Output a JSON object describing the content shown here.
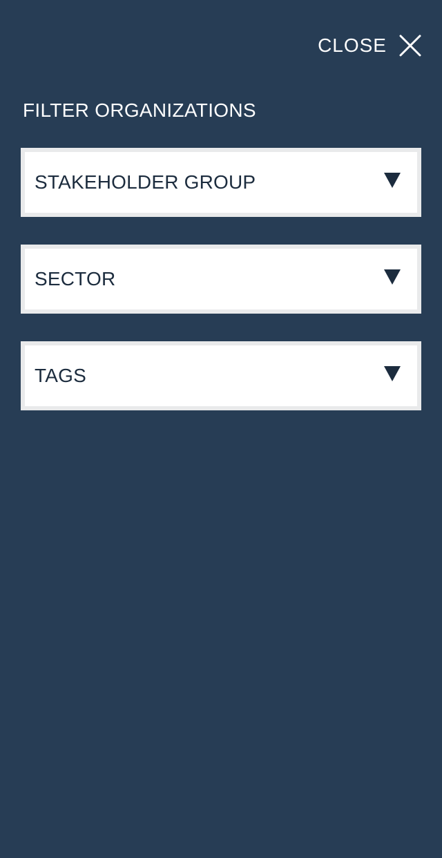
{
  "header": {
    "close_label": "CLOSE",
    "close_icon": "close-icon"
  },
  "filter": {
    "title": "FILTER ORGANIZATIONS",
    "selects": [
      {
        "label": "STAKEHOLDER GROUP",
        "icon": "chevron-down-icon"
      },
      {
        "label": "SECTOR",
        "icon": "chevron-down-icon"
      },
      {
        "label": "TAGS",
        "icon": "chevron-down-icon"
      }
    ]
  },
  "colors": {
    "background": "#273d55",
    "select_background": "#ffffff",
    "select_border": "#e9eaeb",
    "select_text": "#1c2c3e",
    "header_text": "#ffffff"
  }
}
